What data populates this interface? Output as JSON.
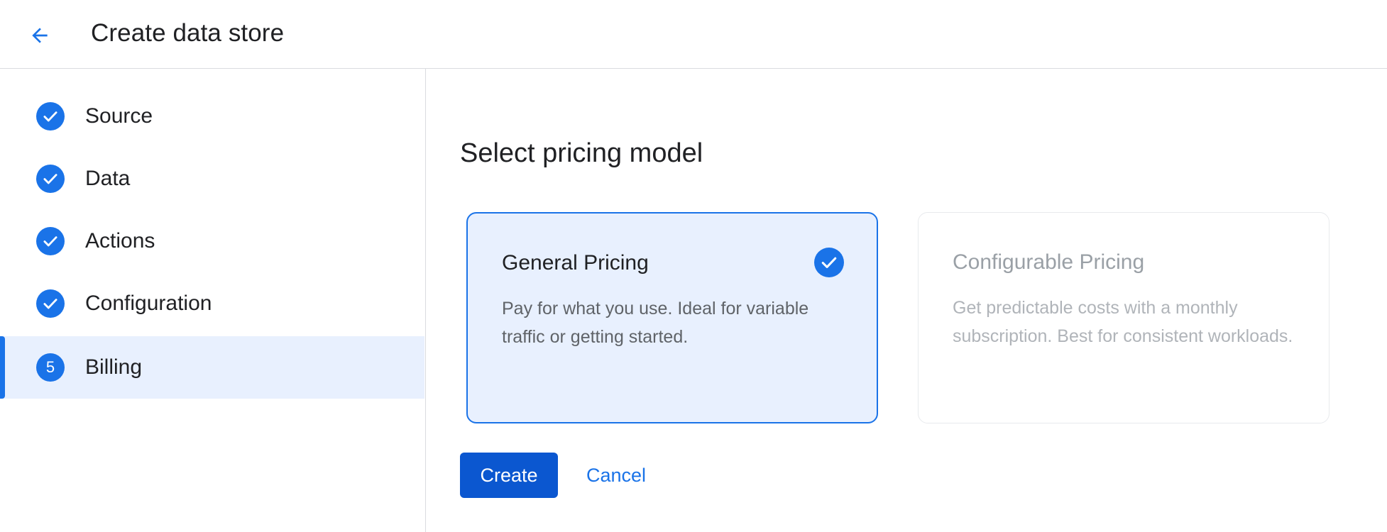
{
  "header": {
    "back_icon": "arrow-back-icon",
    "title": "Create data store"
  },
  "sidebar": {
    "steps": [
      {
        "label": "Source",
        "status": "complete",
        "icon": "check-circle-icon"
      },
      {
        "label": "Data",
        "status": "complete",
        "icon": "check-circle-icon"
      },
      {
        "label": "Actions",
        "status": "complete",
        "icon": "check-circle-icon"
      },
      {
        "label": "Configuration",
        "status": "complete",
        "icon": "check-circle-icon"
      },
      {
        "label": "Billing",
        "status": "current",
        "number": "5"
      }
    ]
  },
  "main": {
    "section_title": "Select pricing model",
    "cards": [
      {
        "title": "General Pricing",
        "description": "Pay for what you use. Ideal for variable traffic or getting started.",
        "selected": true,
        "icon": "check-circle-icon"
      },
      {
        "title": "Configurable Pricing",
        "description": "Get predictable costs with a monthly subscription. Best for consistent workloads.",
        "selected": false
      }
    ],
    "create_label": "Create",
    "cancel_label": "Cancel"
  },
  "colors": {
    "accent": "#1a73e8",
    "primary_button": "#0b57d0",
    "selected_background": "#e8f0fe",
    "divider": "#dadce0"
  }
}
